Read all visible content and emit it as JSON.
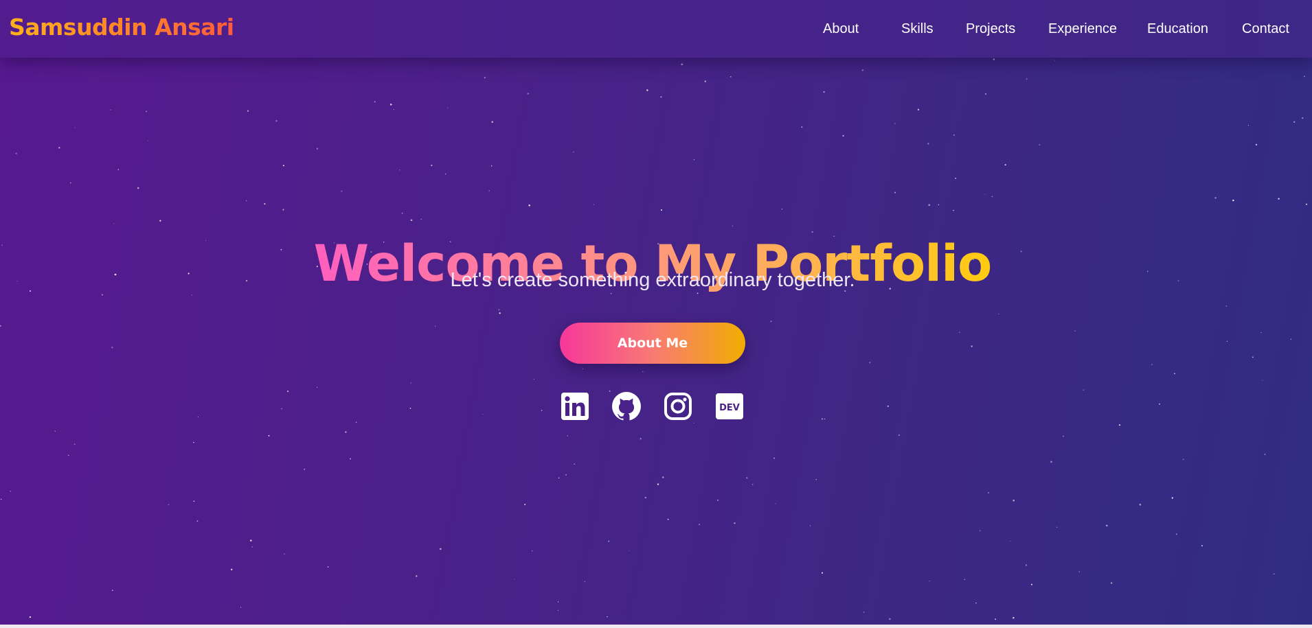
{
  "navbar": {
    "brand": "Samsuddin Ansari",
    "links": [
      {
        "label": "About"
      },
      {
        "label": "Skills"
      },
      {
        "label": "Projects"
      },
      {
        "label": "Experience"
      },
      {
        "label": "Education"
      },
      {
        "label": "Contact"
      }
    ]
  },
  "hero": {
    "headline": "Welcome to My Portfolio",
    "tagline": "Let's create something extraordinary together.",
    "cta_label": "About Me",
    "social": [
      {
        "icon": "linkedin-icon"
      },
      {
        "icon": "github-icon"
      },
      {
        "icon": "instagram-icon"
      },
      {
        "icon": "dev-icon",
        "text": "DEV"
      }
    ]
  },
  "colors": {
    "background_start": "#571990",
    "background_end": "#302c84",
    "accent_pink": "#f7379b",
    "accent_gold": "#ffcc10",
    "brand_orange": "#ff8a26"
  }
}
